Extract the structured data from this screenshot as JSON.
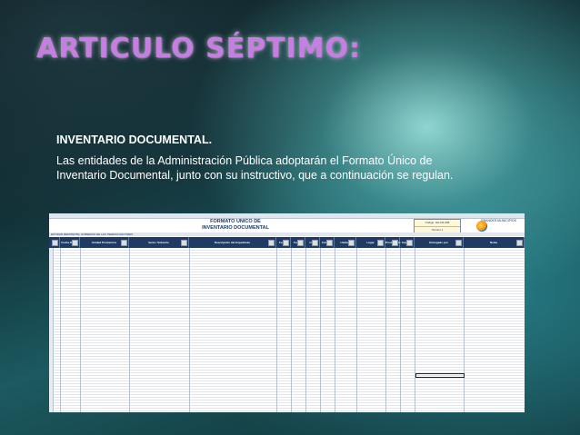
{
  "slide": {
    "title": "ARTICULO SÉPTIMO:",
    "heading": "INVENTARIO DOCUMENTAL.",
    "body": "Las entidades de la Administración Pública adoptarán el Formato Único de Inventario Documental, junto con su instructivo, que a continuación se regulan."
  },
  "spreadsheet": {
    "form_title_line1": "FORMATO UNICO DE",
    "form_title_line2": "INVENTARIO DOCUMENTAL",
    "code_label": "Código: GD-FR-008",
    "version_label": "Versión 1",
    "logo_text": "GRANDES MUNICIPIOS",
    "entity_label": "ENTIDAD REMITENTE: GOBIERNO DE LAS TIERRAS MAYORES",
    "columns": [
      "No",
      "Fecha Orden",
      "Unidad Productora",
      "Serie / Subserie",
      "Descripción del Expediente",
      "Fecha Inicial",
      "Fecha Final",
      "Caja",
      "Carpeta",
      "Unidad Documental",
      "Lugar",
      "Producción",
      "Soporte",
      "Entregado por",
      "Notas"
    ]
  },
  "colors": {
    "title": "#c57fe0",
    "header_bg": "#1f3a63",
    "text": "#ffffff"
  }
}
